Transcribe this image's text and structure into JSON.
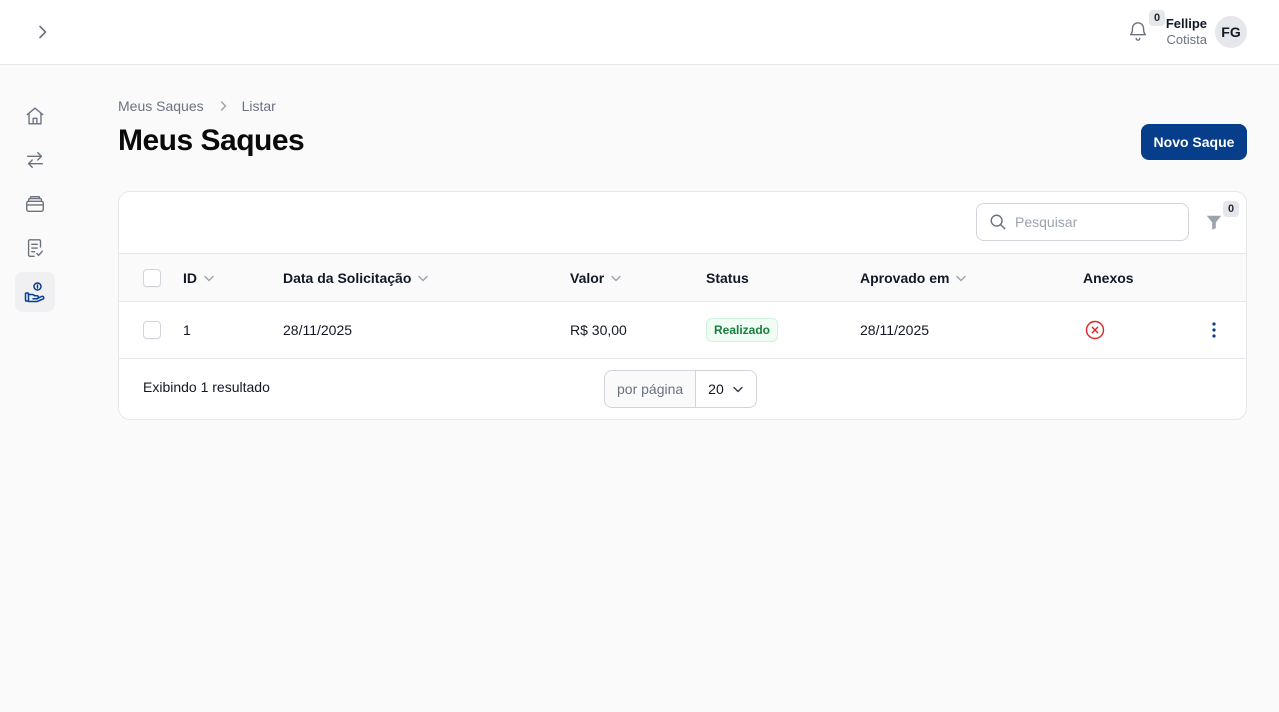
{
  "header": {
    "notifications_count": "0",
    "user_name": "Fellipe",
    "user_role": "Cotista",
    "avatar_initials": "FG"
  },
  "sidebar": {
    "items": [
      {
        "icon": "home-icon",
        "active": false
      },
      {
        "icon": "transfer-icon",
        "active": false
      },
      {
        "icon": "wallet-icon",
        "active": false
      },
      {
        "icon": "document-check-icon",
        "active": false
      },
      {
        "icon": "hand-money-icon",
        "active": true
      }
    ]
  },
  "breadcrumb": {
    "items": [
      "Meus Saques",
      "Listar"
    ]
  },
  "page": {
    "title": "Meus Saques",
    "primary_action": "Novo Saque"
  },
  "table": {
    "search_placeholder": "Pesquisar",
    "filter_count": "0",
    "columns": {
      "id": "ID",
      "date": "Data da Solicitação",
      "value": "Valor",
      "status": "Status",
      "approved": "Aprovado em",
      "attachments": "Anexos"
    },
    "rows": [
      {
        "id": "1",
        "date": "28/11/2025",
        "value": "R$ 30,00",
        "status": "Realizado",
        "approved": "28/11/2025",
        "attachments_icon": "x-circle-icon"
      }
    ],
    "footer": {
      "result_text": "Exibindo 1 resultado",
      "per_page_label": "por página",
      "per_page_value": "20"
    }
  },
  "colors": {
    "primary": "#063e8c",
    "success": "#15803d",
    "danger": "#dc2626"
  }
}
